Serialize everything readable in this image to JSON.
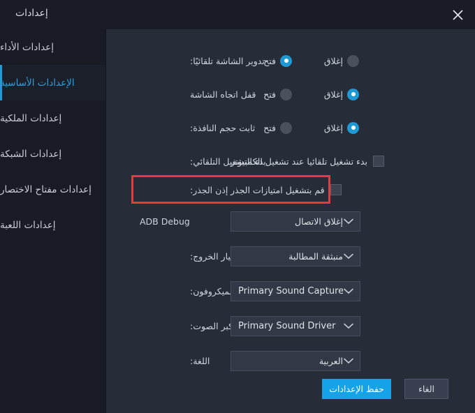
{
  "window": {
    "title": "إعدادات",
    "close_icon": "close-icon"
  },
  "sidebar": {
    "items": [
      {
        "label": "إعدادات الأداء",
        "active": false
      },
      {
        "label": "الإعدادات الأساسية",
        "active": true
      },
      {
        "label": "إعدادات الملكية",
        "active": false
      },
      {
        "label": "إعدادات الشبكة",
        "active": false
      },
      {
        "label": "إعدادات مفتاح الاختصار",
        "active": false
      },
      {
        "label": "إعدادات اللعبة",
        "active": false
      }
    ]
  },
  "main": {
    "rows": [
      {
        "type": "radio",
        "label": "تدوير الشاشة تلقائيًا:",
        "options": [
          {
            "label": "فتح",
            "selected": true
          },
          {
            "label": "إغلاق",
            "selected": false
          }
        ]
      },
      {
        "type": "radio",
        "label": "قفل اتجاه الشاشة",
        "options": [
          {
            "label": "فتح",
            "selected": false
          },
          {
            "label": "إغلاق",
            "selected": true
          }
        ]
      },
      {
        "type": "radio",
        "label": "ثابت حجم النافذة:",
        "options": [
          {
            "label": "فتح",
            "selected": false
          },
          {
            "label": "إغلاق",
            "selected": true
          }
        ]
      },
      {
        "type": "checkbox",
        "label": "بدء التشغيل التلقائي:",
        "checkbox_label": "بدء تشغيل تلقائيا عند تشغيل الكمبيوتر",
        "checked": false
      },
      {
        "type": "checkbox",
        "label": "إذن الجذر:",
        "checkbox_label": "قم بتشغيل امتيازات الجذر",
        "checked": false,
        "highlighted": true
      },
      {
        "type": "dropdown",
        "label": "ADB Debug",
        "label_ltr": true,
        "value": "إغلاق الاتصال",
        "value_ltr": false
      },
      {
        "type": "dropdown",
        "label": "خيار الخروج:",
        "value": "منبثقة المطالبة",
        "value_ltr": false
      },
      {
        "type": "dropdown",
        "label": "الميكروفون:",
        "value": "Primary Sound Capture ...",
        "value_ltr": true
      },
      {
        "type": "dropdown",
        "label": "مكبر الصوت:",
        "value": "Primary Sound Driver",
        "value_ltr": true
      },
      {
        "type": "dropdown",
        "label": "اللغة:",
        "value": "العربية",
        "value_ltr": false
      }
    ],
    "save_label": "حفظ الإعدادات",
    "cancel_label": "الغاء"
  },
  "colors": {
    "accent": "#15a2e8",
    "highlight": "#e8393b",
    "sidebar_bg": "#181b23",
    "panel_bg": "#272c39",
    "active_text": "#2e9fe0"
  }
}
